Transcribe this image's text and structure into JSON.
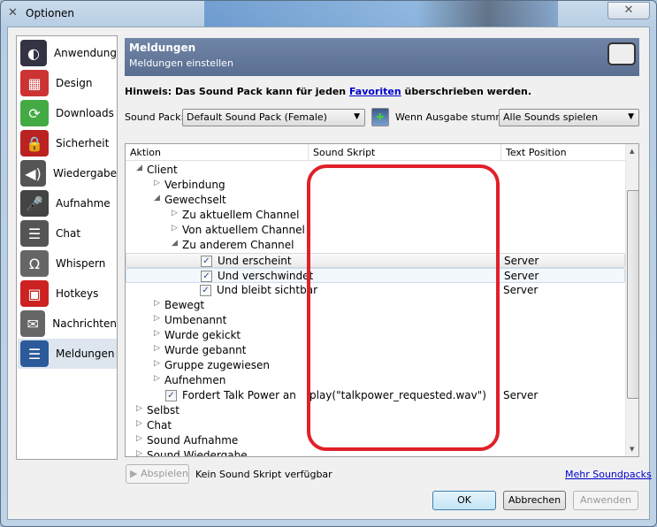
{
  "window": {
    "title": "Optionen",
    "close_icon": "close-icon"
  },
  "sidebar": {
    "items": [
      {
        "label": "Anwendung",
        "icon": "teamspeak-icon",
        "color": "#334"
      },
      {
        "label": "Design",
        "icon": "palette-icon",
        "color": "#c33"
      },
      {
        "label": "Downloads",
        "icon": "downloads-icon",
        "color": "#4a4"
      },
      {
        "label": "Sicherheit",
        "icon": "lock-icon",
        "color": "#b22"
      },
      {
        "label": "Wiedergabe",
        "icon": "speaker-icon",
        "color": "#555"
      },
      {
        "label": "Aufnahme",
        "icon": "microphone-icon",
        "color": "#444"
      },
      {
        "label": "Chat",
        "icon": "chat-icon",
        "color": "#555"
      },
      {
        "label": "Whispern",
        "icon": "headset-icon",
        "color": "#666"
      },
      {
        "label": "Hotkeys",
        "icon": "hotkeys-icon",
        "color": "#c22"
      },
      {
        "label": "Nachrichten",
        "icon": "messages-icon",
        "color": "#666"
      },
      {
        "label": "Meldungen",
        "icon": "notifications-icon",
        "color": "#2c5a9a",
        "selected": true
      }
    ]
  },
  "banner": {
    "title": "Meldungen",
    "subtitle": "Meldungen einstellen"
  },
  "hint": {
    "prefix": "Hinweis: Das Sound Pack kann für jeden ",
    "link": "Favoriten",
    "suffix": " überschrieben werden."
  },
  "soundpack": {
    "label": "Sound Pack:",
    "value": "Default Sound Pack (Female)",
    "mute_label": "Wenn Ausgabe stumm:",
    "mute_value": "Alle Sounds spielen"
  },
  "tree": {
    "columns": [
      "Aktion",
      "Sound Skript",
      "Text Position"
    ],
    "rows": [
      {
        "level": 0,
        "arrow": "expanded",
        "label": "Client"
      },
      {
        "level": 1,
        "arrow": "collapsed",
        "label": "Verbindung"
      },
      {
        "level": 1,
        "arrow": "expanded",
        "label": "Gewechselt"
      },
      {
        "level": 2,
        "arrow": "collapsed",
        "label": "Zu aktuellem Channel"
      },
      {
        "level": 2,
        "arrow": "collapsed",
        "label": "Von aktuellem Channel"
      },
      {
        "level": 2,
        "arrow": "expanded",
        "label": "Zu anderem Channel"
      },
      {
        "level": 3,
        "checked": true,
        "label": "Und erscheint",
        "script": "",
        "position": "Server",
        "state": "hover"
      },
      {
        "level": 3,
        "checked": true,
        "label": "Und verschwindet",
        "script": "",
        "position": "Server",
        "state": "selected"
      },
      {
        "level": 3,
        "checked": true,
        "label": "Und bleibt sichtbar",
        "script": "",
        "position": "Server"
      },
      {
        "level": 1,
        "arrow": "collapsed",
        "label": "Bewegt"
      },
      {
        "level": 1,
        "arrow": "collapsed",
        "label": "Umbenannt"
      },
      {
        "level": 1,
        "arrow": "collapsed",
        "label": "Wurde gekickt"
      },
      {
        "level": 1,
        "arrow": "collapsed",
        "label": "Wurde gebannt"
      },
      {
        "level": 1,
        "arrow": "collapsed",
        "label": "Gruppe zugewiesen"
      },
      {
        "level": 1,
        "arrow": "collapsed",
        "label": "Aufnehmen"
      },
      {
        "level": 1,
        "checked": true,
        "leaf": true,
        "label": "Fordert Talk Power an",
        "script": "play(\"talkpower_requested.wav\")",
        "position": "Server"
      },
      {
        "level": 0,
        "arrow": "collapsed",
        "label": "Selbst"
      },
      {
        "level": 0,
        "arrow": "collapsed",
        "label": "Chat"
      },
      {
        "level": 0,
        "arrow": "collapsed",
        "label": "Sound Aufnahme"
      },
      {
        "level": 0,
        "arrow": "collapsed",
        "label": "Sound Wiedergabe"
      }
    ]
  },
  "annotation": {
    "color": "#e0202a"
  },
  "footer": {
    "play": "Abspielen",
    "status": "Kein Sound Skript verfügbar",
    "more": "Mehr Soundpacks",
    "ok": "OK",
    "cancel": "Abbrechen",
    "apply": "Anwenden"
  }
}
